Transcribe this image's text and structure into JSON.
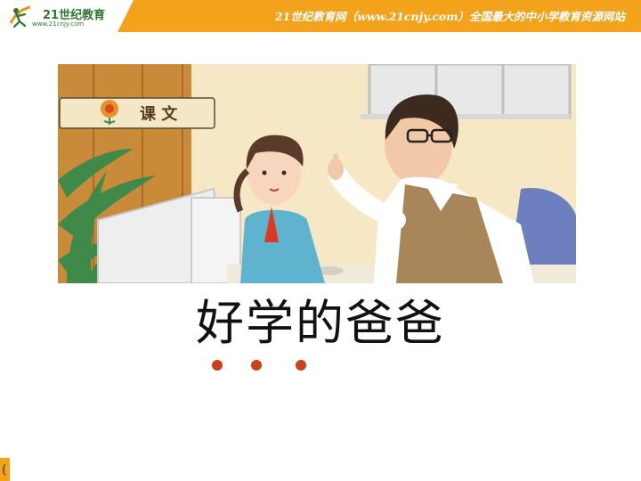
{
  "header": {
    "brand": "21世纪教育",
    "brand_url": "www.21cnjy.com",
    "slogan": "21世纪教育网（www.21cnjy.com）全国最大的中小学教育资源网站"
  },
  "lesson_badge": {
    "label": "课 文"
  },
  "title": "好学的爸爸",
  "corner_glyph": "(",
  "colors": {
    "header": "#f3a21c",
    "dots": "#c9411a",
    "badge_text": "#5a3a20"
  }
}
